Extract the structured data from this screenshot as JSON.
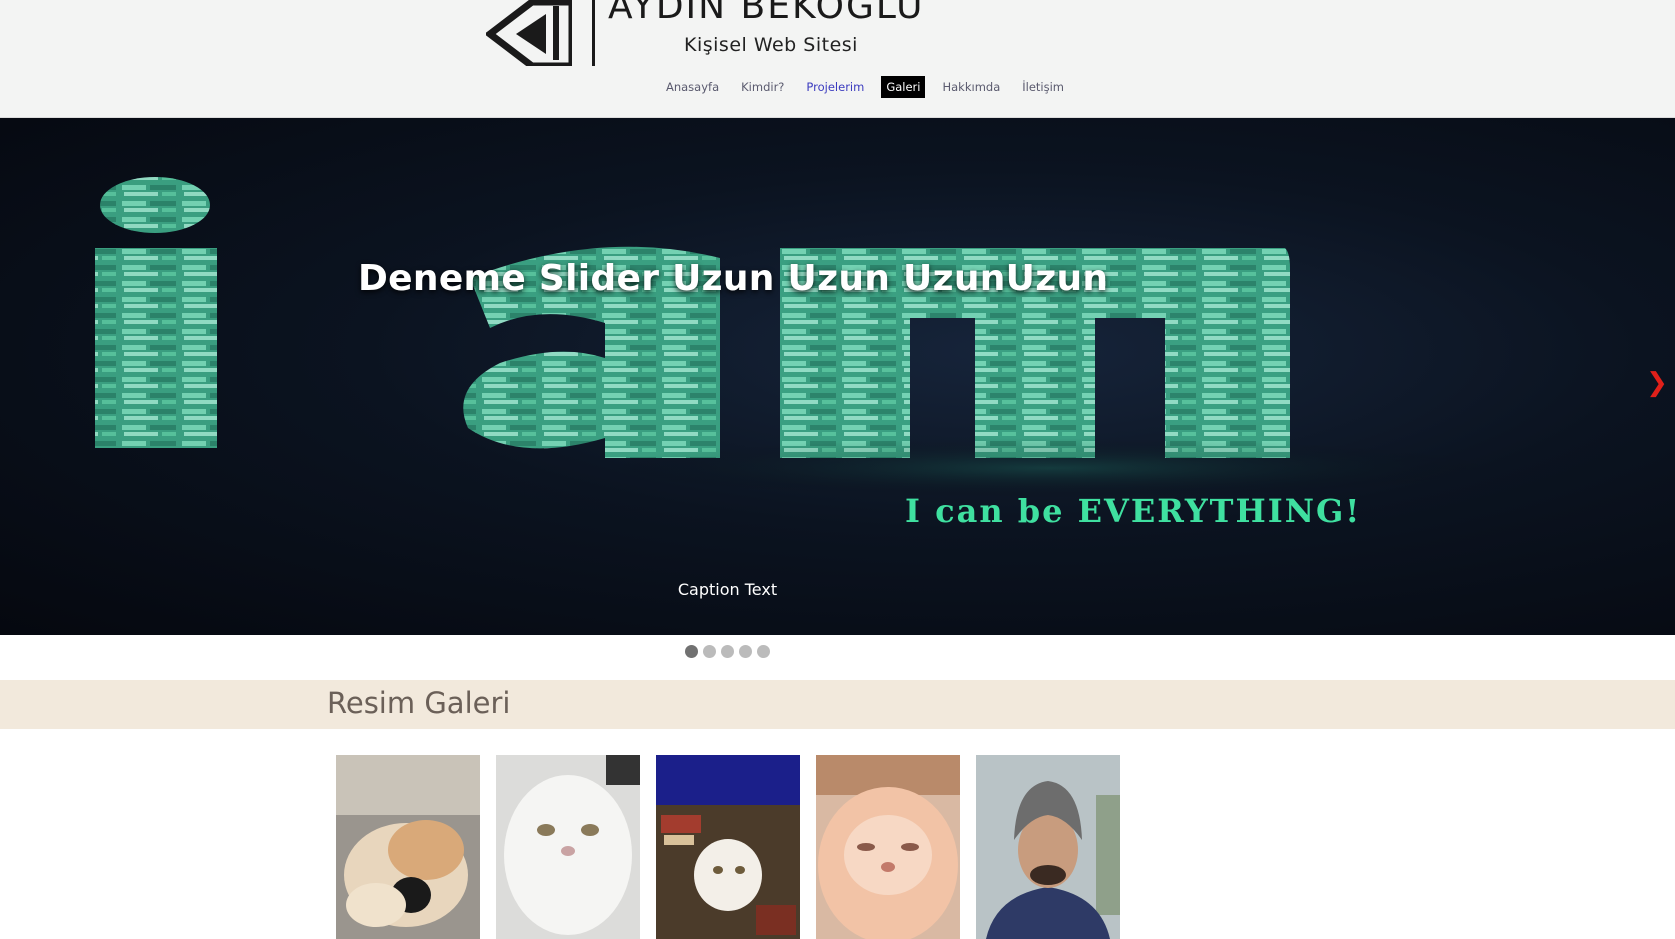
{
  "header": {
    "site_name": "AYDIN BEKOĞLU",
    "subtitle": "Kişisel Web Sitesi",
    "nav": [
      {
        "label": "Anasayfa",
        "state": "normal"
      },
      {
        "label": "Kimdir?",
        "state": "normal"
      },
      {
        "label": "Projelerim",
        "state": "hover"
      },
      {
        "label": "Galeri",
        "state": "active"
      },
      {
        "label": "Hakkımda",
        "state": "normal"
      },
      {
        "label": "İletişim",
        "state": "normal"
      }
    ]
  },
  "slider": {
    "title": "Deneme Slider Uzun Uzun UzunUzun",
    "caption": "Caption Text",
    "next_icon": "chevron-right-icon",
    "slide_count": 5,
    "active_index": 0,
    "artwork_text": {
      "letters": "i am",
      "tagline": "I can be EVERYTHING!"
    }
  },
  "gallery": {
    "title": "Resim Galeri",
    "images": [
      {
        "name": "sleeping-cat-with-plush"
      },
      {
        "name": "white-persian-cat"
      },
      {
        "name": "white-cat-on-floor"
      },
      {
        "name": "orange-persian-cat"
      },
      {
        "name": "man-in-beanie"
      }
    ]
  },
  "colors": {
    "header_bg": "#f3f4f3",
    "nav_active_bg": "#000000",
    "nav_hover": "#3b3bbf",
    "arrow": "#e0201a",
    "gallery_band": "#f2e9dc",
    "art_green": "#5fd3a8"
  }
}
